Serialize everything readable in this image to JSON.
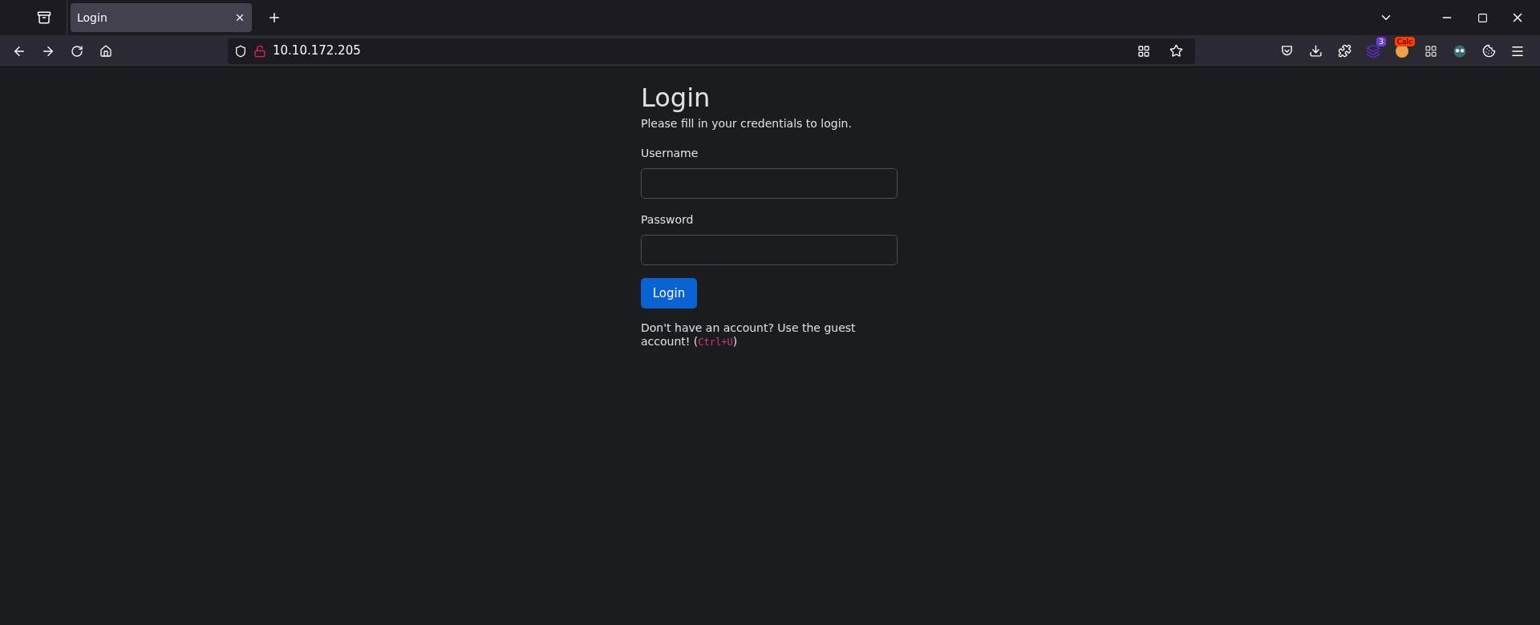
{
  "browser": {
    "tabs": [
      {
        "title": "Login",
        "selected": true
      }
    ],
    "address": "10.10.172.205",
    "extension_badges": [
      {
        "kind": "count",
        "text": "3"
      },
      {
        "kind": "label",
        "text": "Calc"
      }
    ]
  },
  "page": {
    "title": "Login",
    "subtitle": "Please fill in your credentials to login.",
    "fields": [
      {
        "label": "Username"
      },
      {
        "label": "Password"
      }
    ],
    "submit": "Login",
    "note": {
      "before": "Don't have an account? Use the guest account! (",
      "shortcut": "Ctrl+U",
      "after": ")"
    }
  }
}
